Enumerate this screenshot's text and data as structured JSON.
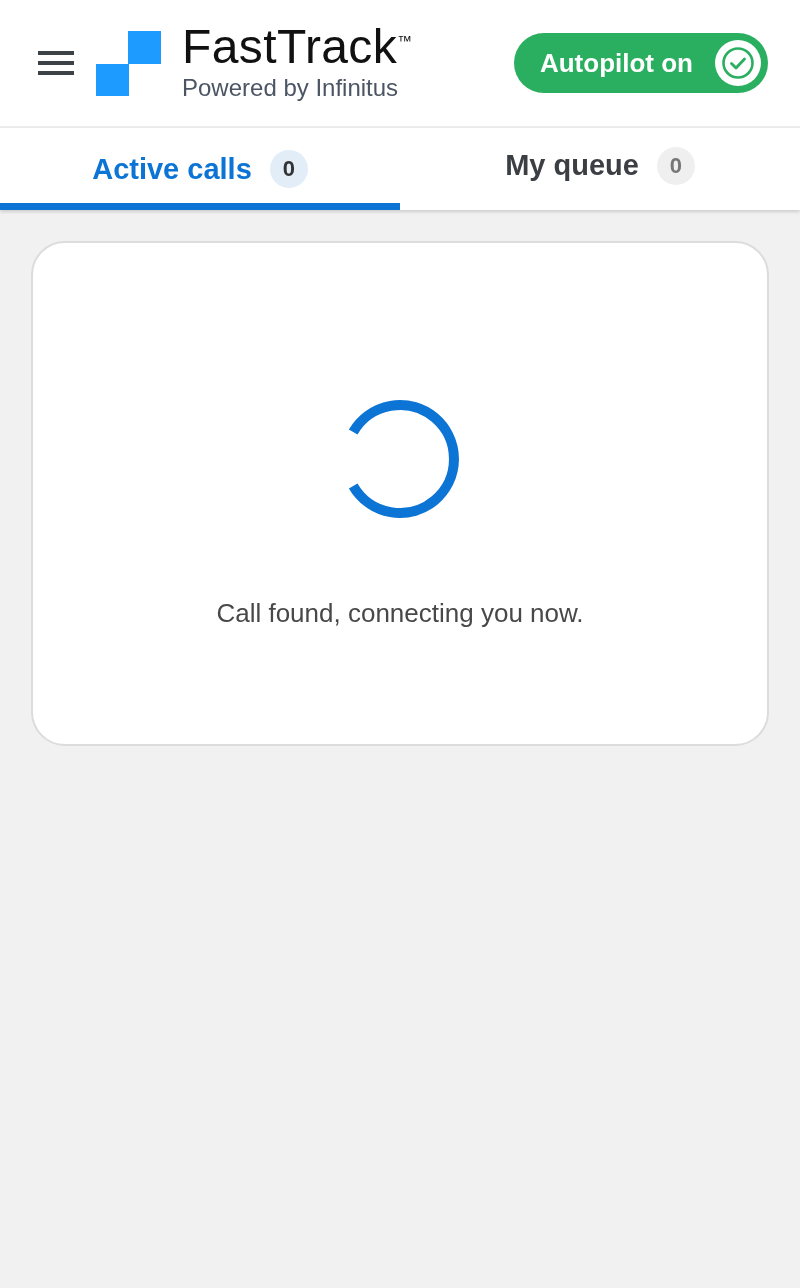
{
  "header": {
    "brand": {
      "name": "FastTrack$^{™}$",
      "tagline": "Powered by Infinitus"
    },
    "autopilot": {
      "label": "Autopilot on",
      "on": true
    }
  },
  "tabs": [
    {
      "label": "Active calls",
      "count": "0",
      "selected": true
    },
    {
      "label": "My queue",
      "count": "0",
      "selected": false
    }
  ],
  "status": {
    "message": "Call found, connecting you now."
  }
}
